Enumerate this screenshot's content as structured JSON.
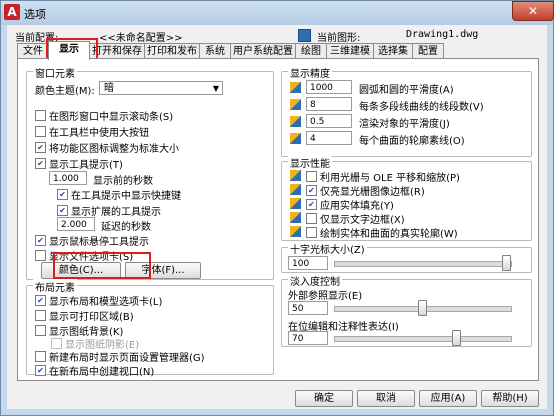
{
  "window": {
    "title": "选项",
    "close": "✕"
  },
  "header": {
    "current_profile_label": "当前配置:",
    "current_profile_value": "<<未命名配置>>",
    "current_file_label": "当前图形:",
    "current_file_value": "Drawing1.dwg"
  },
  "tabs": [
    "文件",
    "显示",
    "打开和保存",
    "打印和发布",
    "系统",
    "用户系统配置",
    "绘图",
    "三维建模",
    "选择集",
    "配置"
  ],
  "left": {
    "window_elements": {
      "title": "窗口元素",
      "color_scheme_label": "颜色主题(M):",
      "color_scheme_value": "暗",
      "options": [
        {
          "label": "在图形窗口中显示滚动条(S)",
          "checked": false
        },
        {
          "label": "在工具栏中使用大按钮",
          "checked": false
        },
        {
          "label": "将功能区图标调整为标准大小",
          "checked": true
        },
        {
          "label": "显示工具提示(T)",
          "checked": true
        }
      ],
      "tooltip_delay_value": "1.000",
      "tooltip_delay_label": "显示前的秒数",
      "sub_options": [
        {
          "label": "在工具提示中显示快捷键",
          "checked": true
        },
        {
          "label": "显示扩展的工具提示",
          "checked": true
        }
      ],
      "ext_delay_value": "2.000",
      "ext_delay_label": "延迟的秒数",
      "options2": [
        {
          "label": "显示鼠标悬停工具提示",
          "checked": true
        },
        {
          "label": "显示文件选项卡(S)",
          "checked": false
        }
      ],
      "colors_button": "颜色(C)...",
      "fonts_button": "字体(F)..."
    },
    "layout_elements": {
      "title": "布局元素",
      "options": [
        {
          "label": "显示布局和模型选项卡(L)",
          "checked": true,
          "disabled": false
        },
        {
          "label": "显示可打印区域(B)",
          "checked": false,
          "disabled": false
        },
        {
          "label": "显示图纸背景(K)",
          "checked": false,
          "disabled": false
        },
        {
          "label": "显示图纸阴影(E)",
          "checked": false,
          "disabled": true
        },
        {
          "label": "新建布局时显示页面设置管理器(G)",
          "checked": false,
          "disabled": false
        },
        {
          "label": "在新布局中创建视口(N)",
          "checked": true,
          "disabled": false
        }
      ]
    }
  },
  "right": {
    "resolution": {
      "title": "显示精度",
      "items": [
        {
          "value": "1000",
          "label": "圆弧和圆的平滑度(A)"
        },
        {
          "value": "8",
          "label": "每条多段线曲线的线段数(V)"
        },
        {
          "value": "0.5",
          "label": "渲染对象的平滑度(J)"
        },
        {
          "value": "4",
          "label": "每个曲面的轮廓素线(O)"
        }
      ]
    },
    "performance": {
      "title": "显示性能",
      "items": [
        {
          "label": "利用光栅与 OLE 平移和缩放(P)",
          "checked": false
        },
        {
          "label": "仅亮显光栅图像边框(R)",
          "checked": true
        },
        {
          "label": "应用实体填充(Y)",
          "checked": true
        },
        {
          "label": "仅显示文字边框(X)",
          "checked": false
        },
        {
          "label": "绘制实体和曲面的真实轮廓(W)",
          "checked": false
        }
      ]
    },
    "crosshair": {
      "title": "十字光标大小(Z)",
      "value": "100",
      "level": 100
    },
    "fade": {
      "title": "淡入度控制",
      "xref_label": "外部参照显示(E)",
      "xref_value": "50",
      "xref_level": 50,
      "inplace_label": "在位编辑和注释性表达(I)",
      "inplace_value": "70",
      "inplace_level": 70
    }
  },
  "footer": {
    "ok": "确定",
    "cancel": "取消",
    "apply": "应用(A)",
    "help": "帮助(H)"
  },
  "colors": {
    "highlight": "#e01b1b",
    "accent": "#1a4f9c"
  }
}
